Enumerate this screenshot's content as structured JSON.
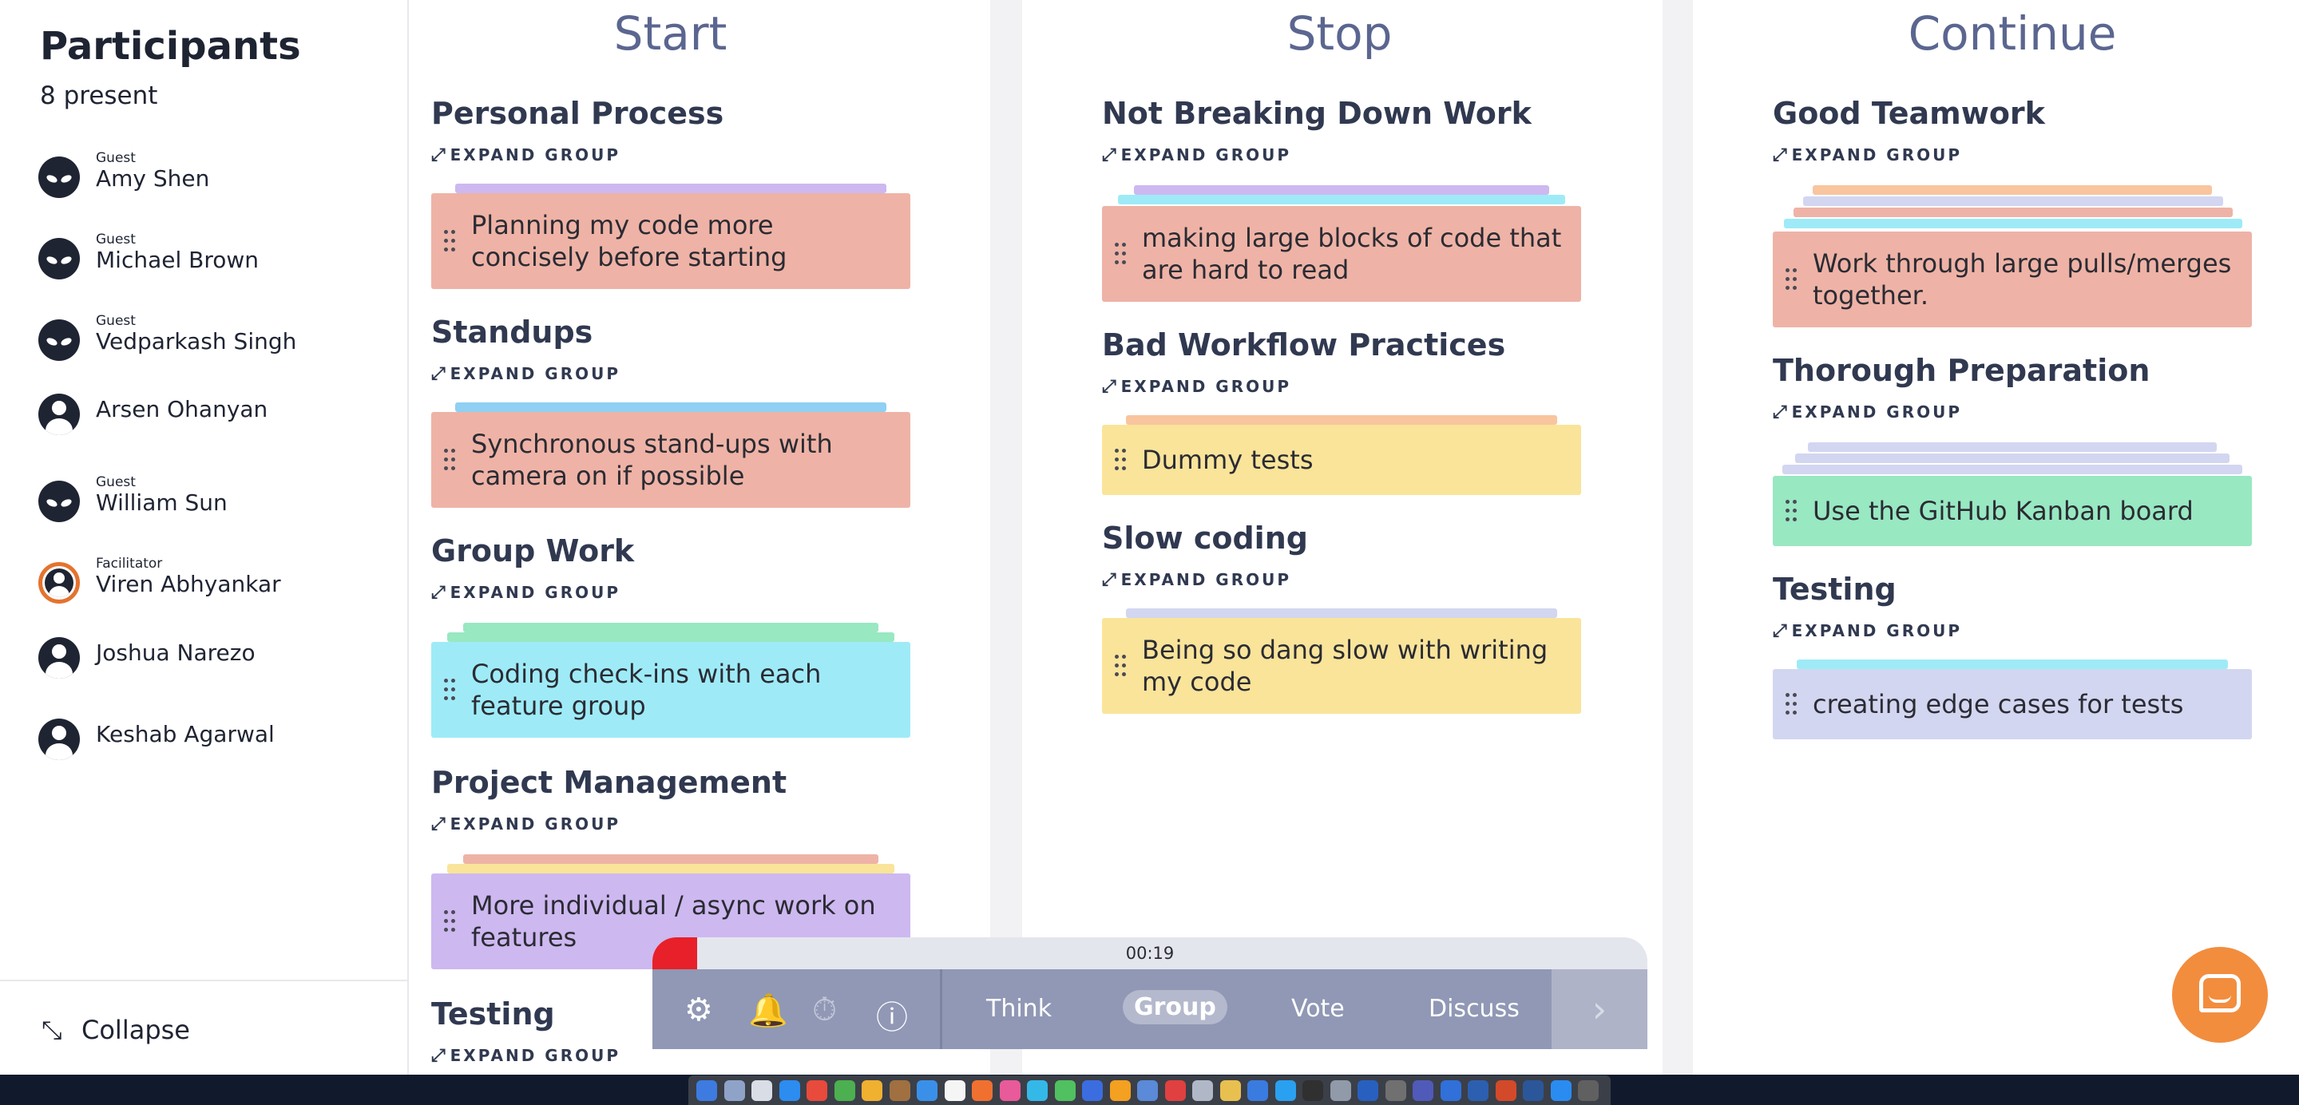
{
  "sidebar": {
    "title": "Participants",
    "count": "8 present",
    "participants": [
      {
        "role": "Guest",
        "name": "Amy Shen",
        "avatar": "alien"
      },
      {
        "role": "Guest",
        "name": "Michael Brown",
        "avatar": "alien"
      },
      {
        "role": "Guest",
        "name": "Vedparkash Singh",
        "avatar": "alien"
      },
      {
        "role": "",
        "name": "Arsen Ohanyan",
        "avatar": "person"
      },
      {
        "role": "Guest",
        "name": "William Sun",
        "avatar": "alien"
      },
      {
        "role": "Facilitator",
        "name": "Viren Abhyankar",
        "avatar": "person-ring"
      },
      {
        "role": "",
        "name": "Joshua Narezo",
        "avatar": "person"
      },
      {
        "role": "",
        "name": "Keshab Agarwal",
        "avatar": "person"
      }
    ],
    "collapse_label": "Collapse",
    "collapse_icon": "collapse-arrows-icon"
  },
  "expand_label": "EXPAND GROUP",
  "colors": {
    "salmon": "#eeb3a6",
    "yellow": "#f9e49a",
    "cyan": "#9eebf7",
    "lavender": "#cdb8f0",
    "mint": "#98e8c2",
    "periwinkle": "#d2d6f0",
    "peach": "#f8c59e",
    "blue": "#8fd0f3"
  },
  "columns": [
    {
      "title": "Start",
      "groups": [
        {
          "title": "Personal Process",
          "cards": [
            "Planning my code more concisely before starting"
          ]
        },
        {
          "title": "Standups",
          "cards": [
            "Synchronous stand-ups with camera on if possible"
          ]
        },
        {
          "title": "Group Work",
          "cards": [
            "Coding check-ins with each feature group"
          ]
        },
        {
          "title": "Project Management",
          "cards": [
            "More individual / async work on features"
          ]
        },
        {
          "title": "Testing",
          "cards": []
        }
      ]
    },
    {
      "title": "Stop",
      "groups": [
        {
          "title": "Not Breaking Down Work",
          "cards": [
            "making large blocks of code that are hard to read"
          ]
        },
        {
          "title": "Bad Workflow Practices",
          "cards": [
            "Dummy tests"
          ]
        },
        {
          "title": "Slow coding",
          "cards": [
            "Being so dang slow with writing my code"
          ]
        }
      ]
    },
    {
      "title": "Continue",
      "groups": [
        {
          "title": "Good Teamwork",
          "cards": [
            "Work through large pulls/merges together."
          ]
        },
        {
          "title": "Thorough Preparation",
          "cards": [
            "Use the GitHub Kanban board"
          ]
        },
        {
          "title": "Testing",
          "cards": [
            "creating edge cases for tests"
          ]
        }
      ]
    }
  ],
  "timer": {
    "text": "00:19",
    "progress": 0.045,
    "color": "#e8202a"
  },
  "toolbar": {
    "icons": [
      "gear-icon",
      "bell-icon",
      "stopwatch-icon",
      "info-icon"
    ],
    "phases": [
      "Think",
      "Group",
      "Vote",
      "Discuss"
    ],
    "active_phase": "Group",
    "next_icon": "chevron-right-icon"
  },
  "chat": {
    "icon": "chat-icon",
    "color": "#f28d3e"
  }
}
